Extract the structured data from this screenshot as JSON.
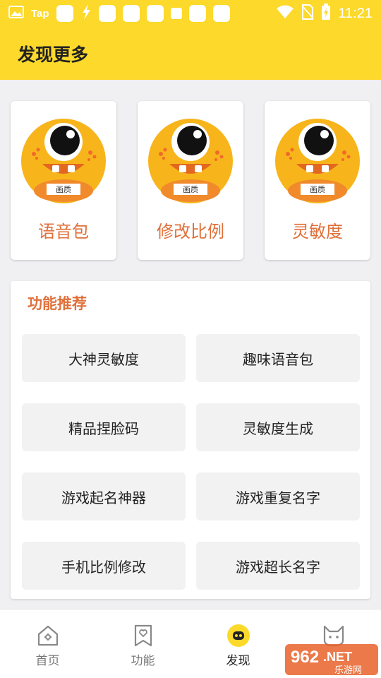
{
  "status_bar": {
    "tap_text": "Tap",
    "time": "11:21",
    "icons": [
      "gallery-icon",
      "tap-icon",
      "notification-icon",
      "wifi-icon",
      "no-sim-icon",
      "battery-charging-icon"
    ]
  },
  "header": {
    "title": "发现更多"
  },
  "cards": [
    {
      "label": "语音包",
      "badge": "画质"
    },
    {
      "label": "修改比例",
      "badge": "画质"
    },
    {
      "label": "灵敏度",
      "badge": "画质"
    }
  ],
  "features": {
    "title": "功能推荐",
    "items": [
      {
        "label": "大神灵敏度"
      },
      {
        "label": "趣味语音包"
      },
      {
        "label": "精品捏脸码"
      },
      {
        "label": "灵敏度生成"
      },
      {
        "label": "游戏起名神器"
      },
      {
        "label": "游戏重复名字"
      },
      {
        "label": "手机比例修改"
      },
      {
        "label": "游戏超长名字"
      }
    ]
  },
  "bottom_nav": {
    "items": [
      {
        "label": "首页",
        "icon": "home-icon"
      },
      {
        "label": "功能",
        "icon": "heart-tag-icon"
      },
      {
        "label": "发现",
        "icon": "discover-icon"
      },
      {
        "label": "",
        "icon": "cat-icon"
      }
    ],
    "active_index": 2
  },
  "watermark": {
    "number": "962",
    "suffix": ".NET",
    "site": "乐游网"
  },
  "colors": {
    "brand_yellow": "#fcd92a",
    "accent_orange": "#e0703a",
    "background": "#f0f0f2",
    "button_gray": "#f2f2f2"
  }
}
